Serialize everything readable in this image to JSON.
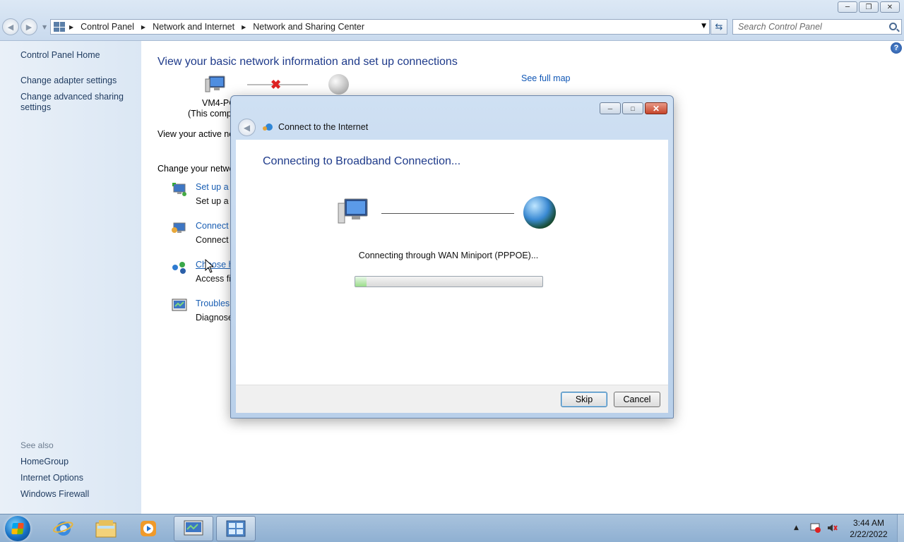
{
  "window": {
    "breadcrumbs": [
      "Control Panel",
      "Network and Internet",
      "Network and Sharing Center"
    ],
    "search_placeholder": "Search Control Panel"
  },
  "sidebar": {
    "home": "Control Panel Home",
    "links": [
      "Change adapter settings",
      "Change advanced sharing\nsettings"
    ],
    "see_also_label": "See also",
    "see_also": [
      "HomeGroup",
      "Internet Options",
      "Windows Firewall"
    ]
  },
  "main": {
    "title": "View your basic network information and set up connections",
    "see_full_map": "See full map",
    "computer_name": "VM4-PC",
    "computer_sub": "(This comp",
    "active_networks_label": "View your active ne",
    "change_settings_label": "Change your netwo",
    "tasks": [
      {
        "link": "Set up a n",
        "desc": "Set up a w",
        "icon": "network-setup-icon"
      },
      {
        "link": "Connect t",
        "desc": "Connect",
        "icon": "connect-network-icon"
      },
      {
        "link": "Choose h",
        "desc": "Access fil",
        "icon": "homegroup-icon"
      },
      {
        "link": "Troublesh",
        "desc": "Diagnose",
        "icon": "troubleshoot-icon"
      }
    ]
  },
  "dialog": {
    "title": "Connect to the Internet",
    "heading": "Connecting to Broadband Connection...",
    "status": "Connecting through WAN Miniport (PPPOE)...",
    "progress_fraction": 0.06,
    "skip_label": "Skip",
    "cancel_label": "Cancel"
  },
  "taskbar": {
    "time": "3:44 AM",
    "date": "2/22/2022",
    "pinned": [
      "internet-explorer-icon",
      "windows-explorer-icon",
      "media-player-icon",
      "network-sharing-center-task",
      "control-panel-task"
    ]
  }
}
